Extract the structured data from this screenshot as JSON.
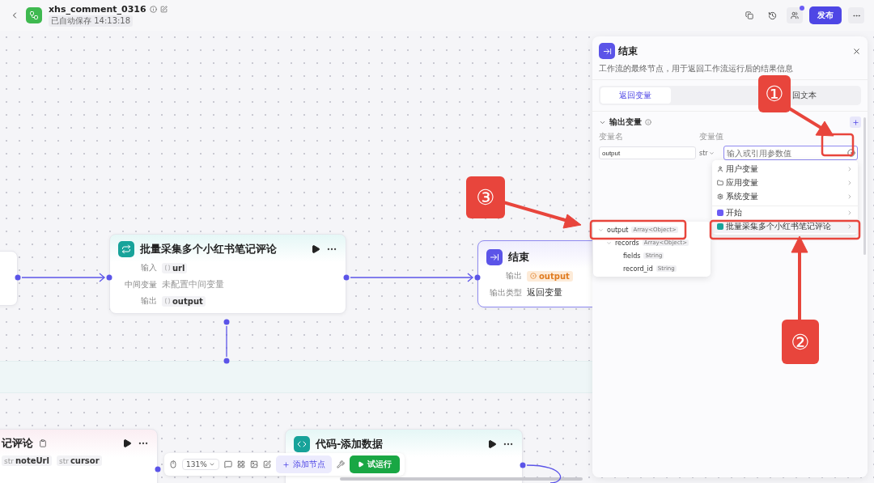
{
  "topbar": {
    "title": "xhs_comment_0316",
    "autosave": "已自动保存 14:13:18",
    "publish": "发布",
    "notification_dot": true
  },
  "canvas": {
    "nodes": [
      {
        "kind": "stub"
      },
      {
        "kind": "loop",
        "title": "批量采集多个小红书笔记评论",
        "rows": [
          {
            "label": "输入",
            "kind": "tag",
            "value": "url"
          },
          {
            "label": "中间变量",
            "kind": "plain",
            "value": "未配置中间变量"
          },
          {
            "label": "输出",
            "kind": "tag",
            "value": "output"
          }
        ]
      },
      {
        "kind": "end",
        "title": "结束",
        "rows": [
          {
            "label": "输出",
            "kind": "ref",
            "value": "output"
          },
          {
            "label": "输出类型",
            "kind": "plain",
            "value": "返回变量"
          }
        ]
      },
      {
        "kind": "loop-partial",
        "title": "记评论",
        "tags": [
          {
            "type": "str",
            "name": "noteUrl"
          },
          {
            "type": "str",
            "name": "cursor"
          }
        ]
      },
      {
        "kind": "code",
        "title": "代码-添加数据"
      }
    ]
  },
  "toolbar": {
    "zoom": "131%",
    "add_node": "添加节点",
    "test_run": "试运行"
  },
  "panel": {
    "title": "结束",
    "description": "工作流的最终节点，用于返回工作流运行后的结果信息",
    "tabs": [
      {
        "label": "返回变量",
        "selected": true
      },
      {
        "label": "回文本",
        "selected": false
      }
    ],
    "section": "输出变量",
    "columns": [
      "变量名",
      "变量值"
    ],
    "row": {
      "name": "output",
      "type": "str",
      "placeholder": "输入或引用参数值"
    },
    "menu": [
      {
        "kind": "user",
        "label": "用户变量",
        "selected": false
      },
      {
        "kind": "app",
        "label": "应用变量",
        "selected": false
      },
      {
        "kind": "system",
        "label": "系统变量",
        "selected": false
      },
      {
        "kind": "start",
        "label": "开始",
        "selected": false
      },
      {
        "kind": "loop",
        "label": "批量采集多个小红书笔记评论",
        "selected": true
      }
    ],
    "tree": [
      {
        "name": "output",
        "type": "Array<Object>",
        "expanded": true,
        "children": [
          {
            "name": "records",
            "type": "Array<Object>",
            "expanded": true,
            "children": [
              {
                "name": "fields",
                "type": "String"
              },
              {
                "name": "record_id",
                "type": "String"
              }
            ]
          }
        ]
      }
    ]
  },
  "annotations": [
    "①",
    "②",
    "③"
  ]
}
